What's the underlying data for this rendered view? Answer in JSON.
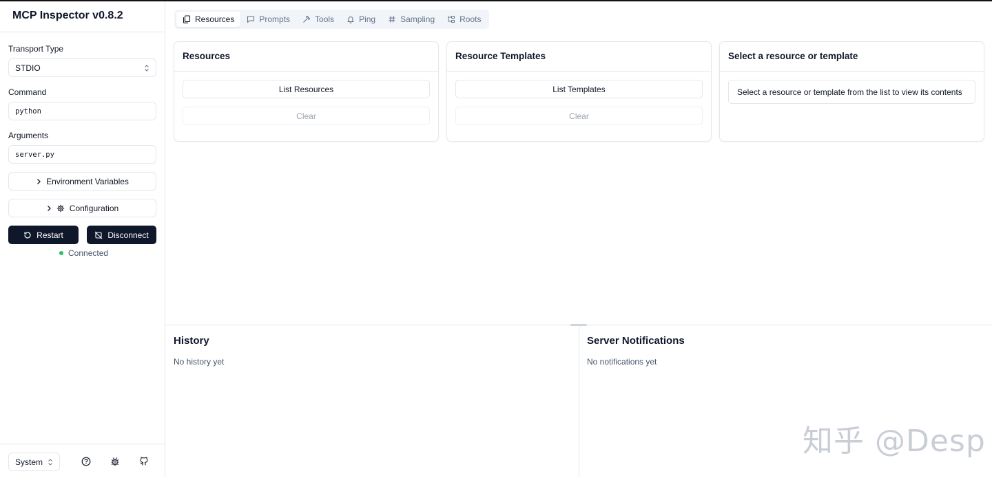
{
  "app": {
    "title": "MCP Inspector v0.8.2"
  },
  "sidebar": {
    "transport_label": "Transport Type",
    "transport_value": "STDIO",
    "command_label": "Command",
    "command_value": "python",
    "arguments_label": "Arguments",
    "arguments_value": "server.py",
    "env_vars_label": "Environment Variables",
    "configuration_label": "Configuration",
    "restart_label": "Restart",
    "disconnect_label": "Disconnect",
    "status_text": "Connected",
    "theme_value": "System"
  },
  "tabs": [
    {
      "label": "Resources",
      "icon": "files-icon",
      "active": true
    },
    {
      "label": "Prompts",
      "icon": "message-square-icon"
    },
    {
      "label": "Tools",
      "icon": "hammer-icon"
    },
    {
      "label": "Ping",
      "icon": "bell-icon"
    },
    {
      "label": "Sampling",
      "icon": "hash-icon"
    },
    {
      "label": "Roots",
      "icon": "folder-tree-icon"
    }
  ],
  "cards": {
    "resources": {
      "title": "Resources",
      "primary_label": "List Resources",
      "clear_label": "Clear"
    },
    "templates": {
      "title": "Resource Templates",
      "primary_label": "List Templates",
      "clear_label": "Clear"
    },
    "selection": {
      "title": "Select a resource or template",
      "hint": "Select a resource or template from the list to view its contents"
    }
  },
  "history": {
    "title": "History",
    "empty": "No history yet"
  },
  "notifications": {
    "title": "Server Notifications",
    "empty": "No notifications yet"
  },
  "watermark": "知乎 @Desp",
  "colors": {
    "primary_dark": "#0f172a",
    "status_green": "#22c55e",
    "border": "#e5e7eb"
  }
}
